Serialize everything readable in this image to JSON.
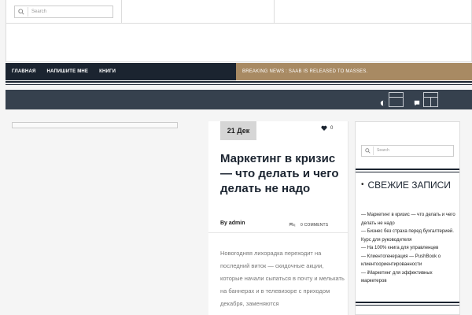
{
  "search": {
    "placeholder": "Search"
  },
  "nav": {
    "items": [
      "ГЛАВНАЯ",
      "НАПИШИТЕ МНЕ",
      "КНИГИ"
    ]
  },
  "breaking": {
    "text": "BREAKING NEWS : SAAB IS RELEASED TO MASSES."
  },
  "article": {
    "date": "21 Дек",
    "likes": "0",
    "title": "Маркетинг в кризис — что делать и чего делать не надо",
    "author": "By admin",
    "comments": "0 COMMENTS",
    "excerpt": "Новогодняя лихорадка переходит на последний виток — скидочные акции, которые начали сыпаться в почту и мелькать на баннерах и в телевизоре с приходом декабря, заменяются"
  },
  "sidebar": {
    "search_placeholder": "Search",
    "widget_title": "СВЕЖИЕ ЗАПИСИ",
    "recent": [
      "— Маркетинг в кризис — что делать и чего делать не надо",
      "— Бизнес без страха перед бухгалтерией. Курс для руководителя",
      "— На 100% книга для управленцев",
      "— Клиентогенерация — PushBook о клиентоориентированности",
      "— iМаркетинг для эффективных маркетеров"
    ]
  },
  "colors": {
    "nav_bg": "#1b2430",
    "breaking_bg": "#a88a63",
    "subbar_bg": "#36414e",
    "date_badge_bg": "#d6d6d6"
  },
  "icons": [
    "search-icon",
    "heart-icon",
    "comment-icon",
    "contrast-icon",
    "chat-icon",
    "layout-icon",
    "grid-icon"
  ]
}
